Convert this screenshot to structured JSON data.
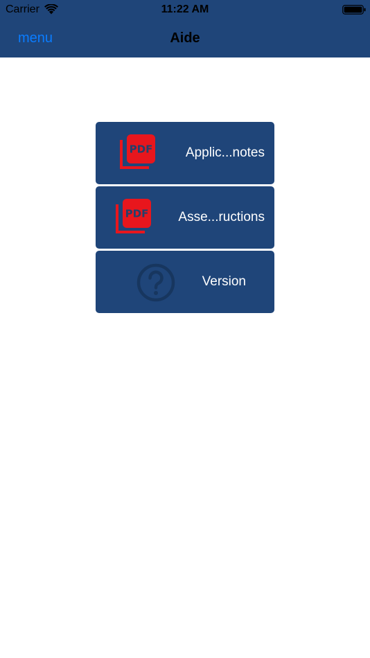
{
  "status_bar": {
    "carrier": "Carrier",
    "time": "11:22 AM",
    "wifi_icon": "wifi-icon",
    "battery_icon": "battery-icon"
  },
  "nav_bar": {
    "menu_label": "menu",
    "title": "Aide"
  },
  "tiles": [
    {
      "label": "Applic...notes",
      "icon": "pdf-icon",
      "icon_text": "PDF"
    },
    {
      "label": "Asse...ructions",
      "icon": "pdf-icon",
      "icon_text": "PDF"
    },
    {
      "label": "Version",
      "icon": "question-circle-icon"
    }
  ],
  "colors": {
    "bar_background": "#1f4579",
    "tile_background": "#1f4579",
    "menu_link": "#0a7cff",
    "pdf_red": "#e8161d",
    "question_icon": "#17365f"
  }
}
